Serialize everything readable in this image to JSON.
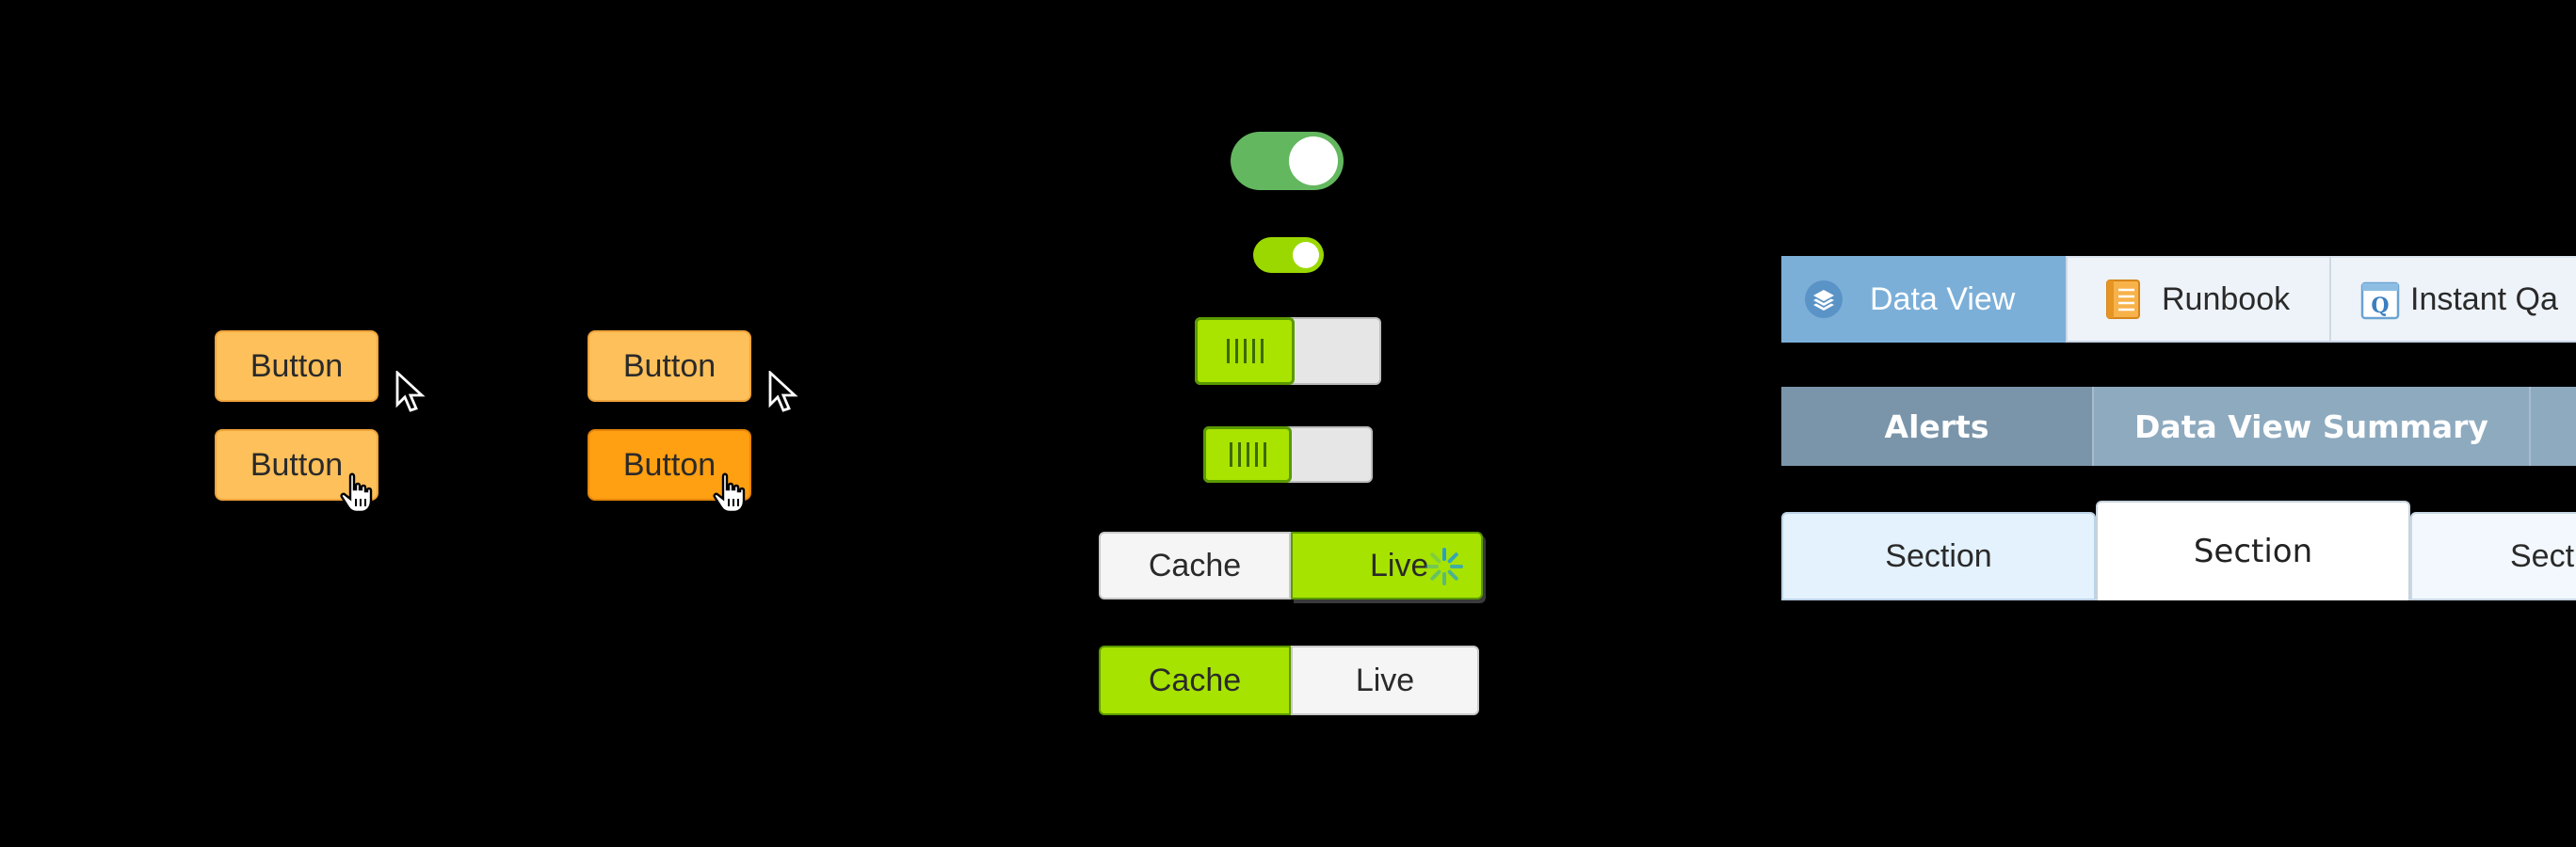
{
  "buttons": {
    "b1": "Button",
    "b2": "Button",
    "b3": "Button",
    "b4": "Button"
  },
  "segmented": {
    "top": {
      "left": "Cache",
      "right": "Live",
      "selected": "Live"
    },
    "bottom": {
      "left": "Cache",
      "right": "Live",
      "selected": "Cache"
    }
  },
  "toggles": {
    "large_pill": {
      "on": true
    },
    "small_pill": {
      "on": true
    },
    "slide_large": {
      "on": true
    },
    "slide_small": {
      "on": true
    }
  },
  "icon_tabs": {
    "items": [
      {
        "label": "Data View",
        "icon": "layers-icon",
        "active": true
      },
      {
        "label": "Runbook",
        "icon": "notebook-icon",
        "active": false
      },
      {
        "label": "Instant Qa",
        "icon": "calendar-q-icon",
        "active": false
      }
    ]
  },
  "header_tabs": {
    "items": [
      {
        "label": "Alerts",
        "active": true
      },
      {
        "label": "Data View Summary",
        "active": false
      }
    ]
  },
  "section_tabs": {
    "items": [
      {
        "label": "Section",
        "state": "hover"
      },
      {
        "label": "Section",
        "state": "active"
      },
      {
        "label": "Sect",
        "state": "inactive"
      }
    ]
  },
  "colors": {
    "button_default": "#fdc05a",
    "button_pressed": "#ff9f12",
    "toggle_green": "#63b75f",
    "lime": "#a6e300",
    "tab_blue": "#7bafd8",
    "header_tab_active": "#7a95aa",
    "header_tab_inactive": "#8eaabf"
  }
}
